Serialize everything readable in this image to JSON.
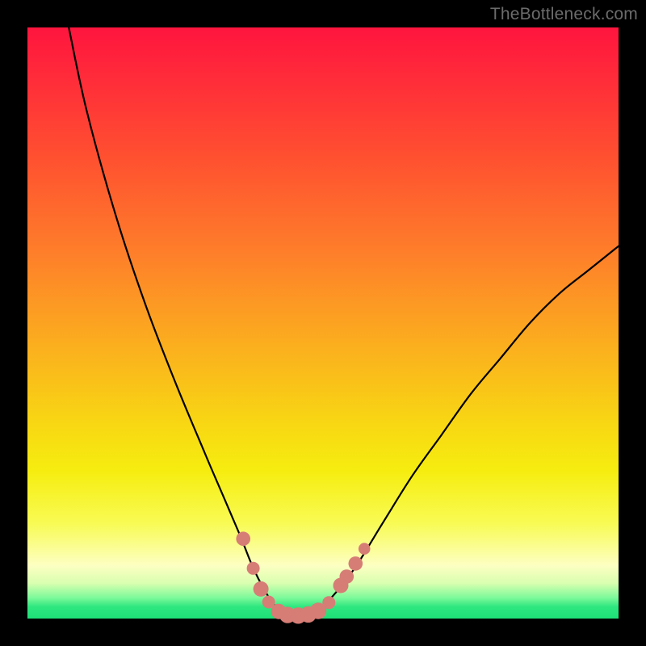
{
  "watermark": "TheBottleneck.com",
  "colors": {
    "frame": "#000000",
    "curve": "#000000",
    "markers_fill": "#d67d76",
    "markers_stroke": "#d67d76"
  },
  "chart_data": {
    "type": "line",
    "title": "",
    "xlabel": "",
    "ylabel": "",
    "xlim": [
      0,
      100
    ],
    "ylim": [
      0,
      100
    ],
    "grid": false,
    "legend": false,
    "series": [
      {
        "name": "bottleneck-curve",
        "x": [
          7,
          10,
          15,
          20,
          25,
          30,
          33,
          36,
          38,
          40,
          42,
          44,
          46,
          48,
          50,
          55,
          60,
          65,
          70,
          75,
          80,
          85,
          90,
          95,
          100
        ],
        "y": [
          100,
          86,
          68,
          53,
          40,
          28,
          21,
          14,
          9,
          5,
          2,
          0.8,
          0.5,
          0.8,
          2,
          8,
          16,
          24,
          31,
          38,
          44,
          50,
          55,
          59,
          63
        ]
      }
    ],
    "markers": [
      {
        "x": 36.5,
        "y": 13.5,
        "r": 1.2
      },
      {
        "x": 38.2,
        "y": 8.5,
        "r": 1.1
      },
      {
        "x": 39.5,
        "y": 5.0,
        "r": 1.3
      },
      {
        "x": 40.8,
        "y": 2.8,
        "r": 1.1
      },
      {
        "x": 42.5,
        "y": 1.2,
        "r": 1.3
      },
      {
        "x": 44.0,
        "y": 0.6,
        "r": 1.4
      },
      {
        "x": 45.8,
        "y": 0.5,
        "r": 1.4
      },
      {
        "x": 47.5,
        "y": 0.7,
        "r": 1.4
      },
      {
        "x": 49.2,
        "y": 1.3,
        "r": 1.4
      },
      {
        "x": 51.0,
        "y": 2.7,
        "r": 1.1
      },
      {
        "x": 53.0,
        "y": 5.6,
        "r": 1.3
      },
      {
        "x": 54.0,
        "y": 7.1,
        "r": 1.2
      },
      {
        "x": 55.5,
        "y": 9.3,
        "r": 1.2
      },
      {
        "x": 57.0,
        "y": 11.8,
        "r": 1.0
      }
    ]
  }
}
